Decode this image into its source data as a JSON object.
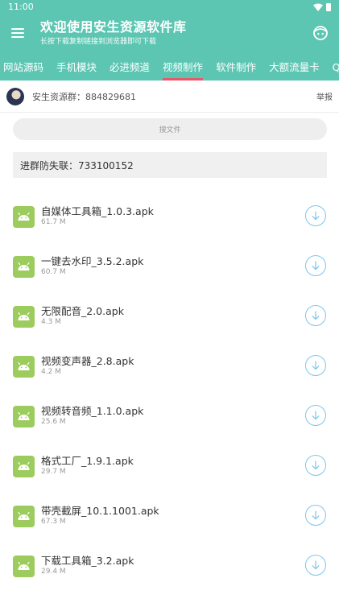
{
  "status_bar": {
    "time": "11:00"
  },
  "app_bar": {
    "title": "欢迎使用安生资源软件库",
    "subtitle": "长按下载复制链接到浏览器即可下载"
  },
  "tabs": [
    {
      "label": "网站源码",
      "active": false
    },
    {
      "label": "手机模块",
      "active": false
    },
    {
      "label": "必进频道",
      "active": false
    },
    {
      "label": "视频制作",
      "active": true
    },
    {
      "label": "软件制作",
      "active": false
    },
    {
      "label": "大额流量卡",
      "active": false
    },
    {
      "label": "QQ等级",
      "active": false
    }
  ],
  "group": {
    "text": "安生资源群：884829681",
    "report": "举报"
  },
  "search": {
    "placeholder": "搜文件"
  },
  "notice": {
    "text": "进群防失联：733100152"
  },
  "files": [
    {
      "name": "自媒体工具箱_1.0.3.apk",
      "size": "61.7 M"
    },
    {
      "name": "一键去水印_3.5.2.apk",
      "size": "60.7 M"
    },
    {
      "name": "无限配音_2.0.apk",
      "size": "4.3 M"
    },
    {
      "name": "视频变声器_2.8.apk",
      "size": "4.2 M"
    },
    {
      "name": "视频转音频_1.1.0.apk",
      "size": "25.6 M"
    },
    {
      "name": "格式工厂_1.9.1.apk",
      "size": "29.7 M"
    },
    {
      "name": "带壳截屏_10.1.1001.apk",
      "size": "67.3 M"
    },
    {
      "name": "下载工具箱_3.2.apk",
      "size": "29.4 M"
    }
  ],
  "colors": {
    "header": "#5cc6b3",
    "tab_indicator": "#e55a6a",
    "apk_icon": "#9ccc5d",
    "download_ring": "#7ec6ea"
  },
  "icons": {
    "menu": "menu-icon",
    "face": "face-icon",
    "file": "android-icon",
    "download": "download-icon"
  }
}
